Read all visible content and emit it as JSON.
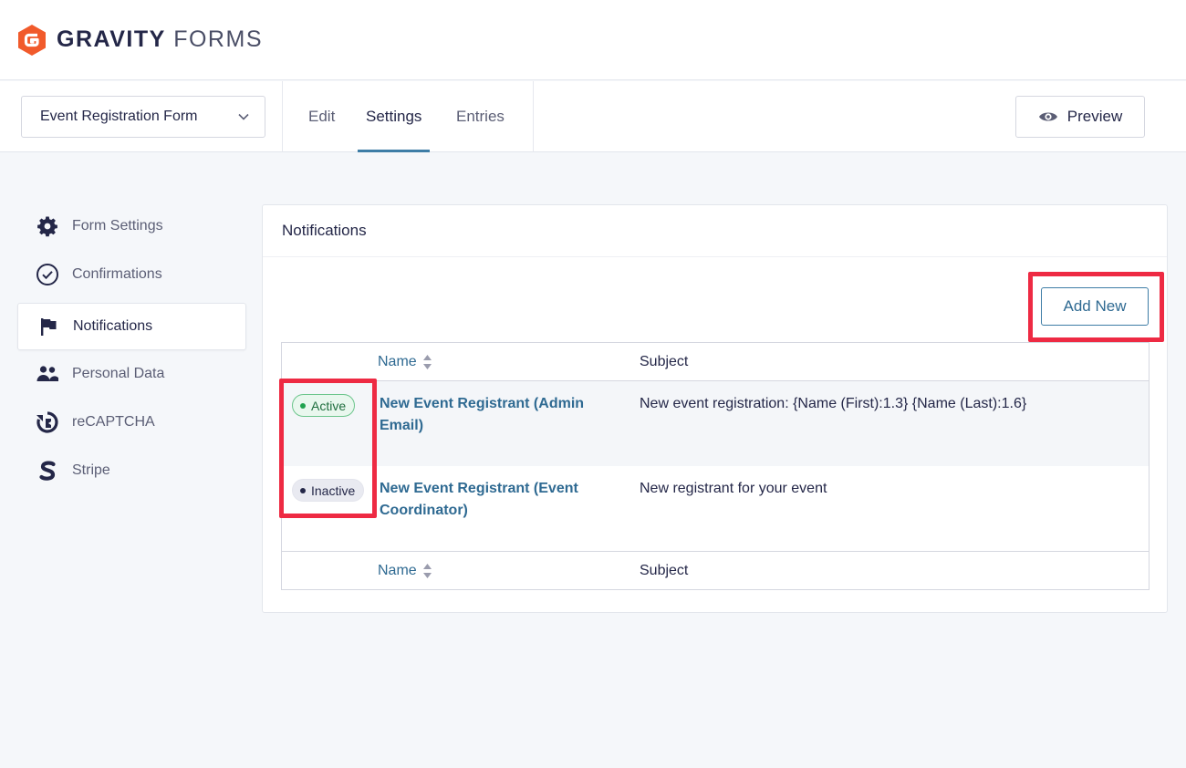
{
  "brand": {
    "name_bold": "GRAVITY",
    "name_light": "FORMS"
  },
  "toolbar": {
    "form_selector": "Event Registration Form",
    "tabs": [
      {
        "label": "Edit",
        "active": false
      },
      {
        "label": "Settings",
        "active": true
      },
      {
        "label": "Entries",
        "active": false
      }
    ],
    "preview_label": "Preview"
  },
  "sidebar": {
    "items": [
      {
        "label": "Form Settings",
        "icon": "gear-icon",
        "active": false
      },
      {
        "label": "Confirmations",
        "icon": "check-circle-icon",
        "active": false
      },
      {
        "label": "Notifications",
        "icon": "flag-icon",
        "active": true
      },
      {
        "label": "Personal Data",
        "icon": "people-icon",
        "active": false
      },
      {
        "label": "reCAPTCHA",
        "icon": "recaptcha-icon",
        "active": false
      },
      {
        "label": "Stripe",
        "icon": "stripe-icon",
        "active": false
      }
    ]
  },
  "panel": {
    "title": "Notifications",
    "add_new_label": "Add New",
    "table": {
      "columns": {
        "name": "Name",
        "subject": "Subject"
      },
      "rows": [
        {
          "status": "Active",
          "name": "New Event Registrant (Admin Email)",
          "subject": "New event registration: {Name (First):1.3} {Name (Last):1.6}"
        },
        {
          "status": "Inactive",
          "name": "New Event Registrant (Event Coordinator)",
          "subject": "New registrant for your event"
        }
      ]
    }
  },
  "colors": {
    "accent": "#3e7da6",
    "link": "#2f6a92",
    "brand_orange": "#f15a2b",
    "highlight": "#ee2a43",
    "active_green": "#20a24f"
  }
}
